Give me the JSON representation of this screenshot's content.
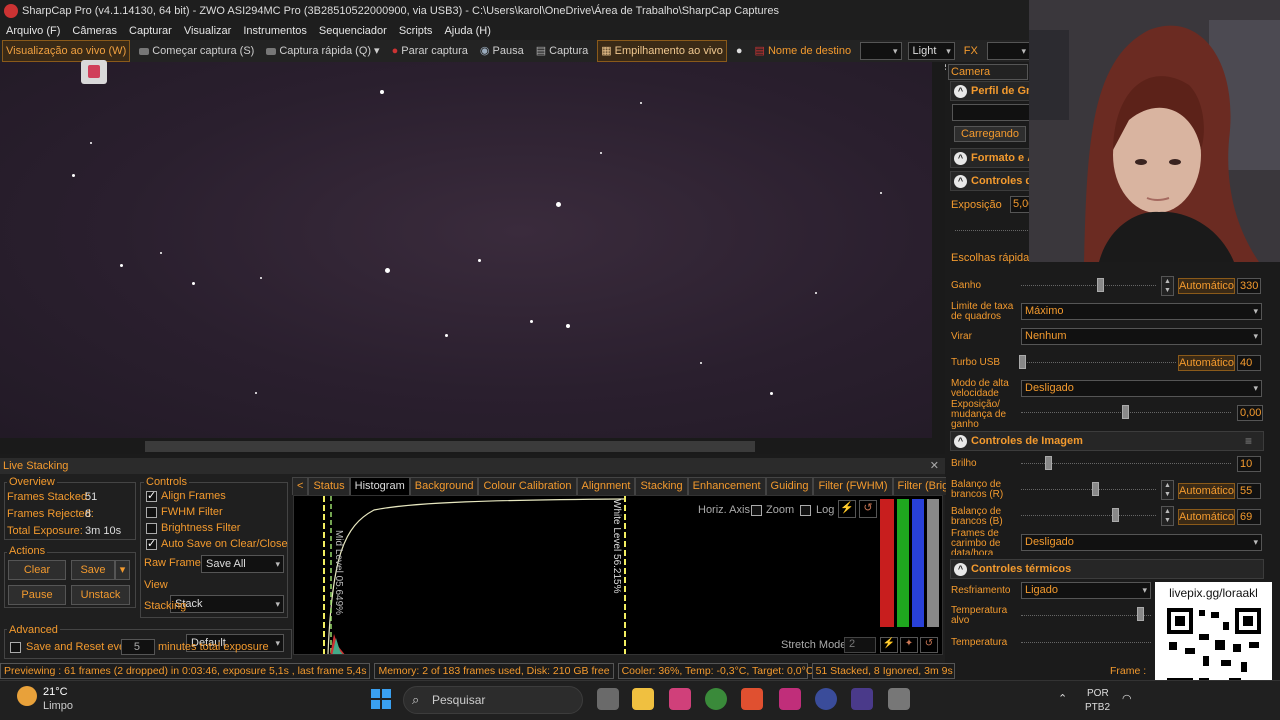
{
  "window": {
    "title": "SharpCap Pro (v4.1.14130, 64 bit) - ZWO ASI294MC Pro (3B28510522000900, via USB3) - C:\\Users\\karol\\OneDrive\\Área de Trabalho\\SharpCap Captures"
  },
  "menu": [
    "Arquivo (F)",
    "Câmeras",
    "Capturar",
    "Visualizar",
    "Instrumentos",
    "Sequenciador",
    "Scripts",
    "Ajuda (H)"
  ],
  "toolbar": {
    "live_view": "Visualização ao vivo (W)",
    "start_capture": "Começar captura (S)",
    "quick_capture": "Captura rápida (Q)",
    "stop_capture": "Parar captura",
    "pause": "Pausa",
    "capture": "Captura",
    "live_stack": "Empilhamento ao vivo",
    "target_name": "Nome de destino",
    "target_value": "",
    "frame_type": "Light Frames",
    "fx": "FX",
    "fx_value": ""
  },
  "live_stacking": {
    "title": "Live Stacking",
    "overview_label": "Overview",
    "frames_stacked_label": "Frames Stacked:",
    "frames_stacked": "51",
    "frames_rejected_label": "Frames Rejected:",
    "frames_rejected": "8",
    "total_exposure_label": "Total Exposure:",
    "total_exposure": "3m 10s",
    "actions_label": "Actions",
    "clear": "Clear",
    "save": "Save",
    "pause": "Pause",
    "unstack": "Unstack",
    "controls_label": "Controls",
    "align_frames": "Align Frames",
    "fwhm_filter": "FWHM Filter",
    "brightness_filter": "Brightness Filter",
    "auto_save": "Auto Save on Clear/Close",
    "raw_frames_label": "Raw Frames",
    "raw_frames_value": "Save All",
    "view_label": "View",
    "view_value": "Stack",
    "stacking_label": "Stacking",
    "stacking_value": "Default",
    "advanced_label": "Advanced",
    "save_reset_label": "Save and Reset every",
    "save_reset_value": "5",
    "save_reset_unit": "minutes total exposure",
    "tabs": [
      "Status",
      "Histogram",
      "Background",
      "Colour Calibration",
      "Alignment",
      "Stacking",
      "Enhancement",
      "Guiding",
      "Filter (FWHM)",
      "Filter (Brightness)"
    ],
    "histogram": {
      "horiz_axis": "Horiz. Axis:",
      "zoom": "Zoom",
      "log": "Log",
      "white_level": "White Level  56.215%",
      "mid_level": "Mid Level  05.649%",
      "stretch_mode": "Stretch Mode",
      "stretch_value": "2"
    }
  },
  "status_bar": {
    "preview": "Previewing : 61 frames (2 dropped) in 0:03:46, exposure 5,1s , last frame 5,4s",
    "memory": "Memory: 2 of 183 frames used, Disk: 210 GB free",
    "cooler": "Cooler: 36%, Temp: -0,3°C, Target: 0,0°C",
    "stack": "51 Stacked, 8 Ignored, 3m 9s",
    "frame": "Frame :"
  },
  "camera_controls": {
    "title": "Camera Controls",
    "profile_section": "Perfil de Gra",
    "loading_btn": "Carregando",
    "format_section": "Formato e Á",
    "capture_section": "Controles da",
    "exposure_label": "Exposição",
    "exposure_value": "5,00",
    "quick_choice": "Escolhas rápidas",
    "gain_label": "Ganho",
    "gain_auto": "Automático",
    "gain_value": "330",
    "framerate_label": "Limite de taxa de quadros",
    "framerate_value": "Máximo",
    "flip_label": "Virar",
    "flip_value": "Nenhum",
    "usb_label": "Turbo USB",
    "usb_auto": "Automático",
    "usb_value": "40",
    "hispeed_label": "Modo de alta velocidade",
    "hispeed_value": "Desligado",
    "expgain_label": "Exposição/ mudança de ganho",
    "expgain_value": "0,00",
    "image_section": "Controles de Imagem",
    "brightness_label": "Brilho",
    "brightness_value": "10",
    "wbr_label": "Balanço de brancos (R)",
    "wbr_auto": "Automático",
    "wbr_value": "55",
    "wbb_label": "Balanço de brancos (B)",
    "wbb_auto": "Automático",
    "wbb_value": "69",
    "timestamp_label": "Frames de carimbo de data/hora",
    "timestamp_value": "Desligado",
    "thermal_section": "Controles térmicos",
    "cooling_label": "Resfriamento",
    "cooling_value": "Ligado",
    "target_temp_label": "Temperatura alvo",
    "temp_label": "Temperatura"
  },
  "overlay": {
    "qr_text": "livepix.gg/loraakl"
  },
  "taskbar": {
    "weather_temp": "21°C",
    "weather_desc": "Limpo",
    "search": "Pesquisar",
    "lang1": "POR",
    "lang2": "PTB2"
  }
}
